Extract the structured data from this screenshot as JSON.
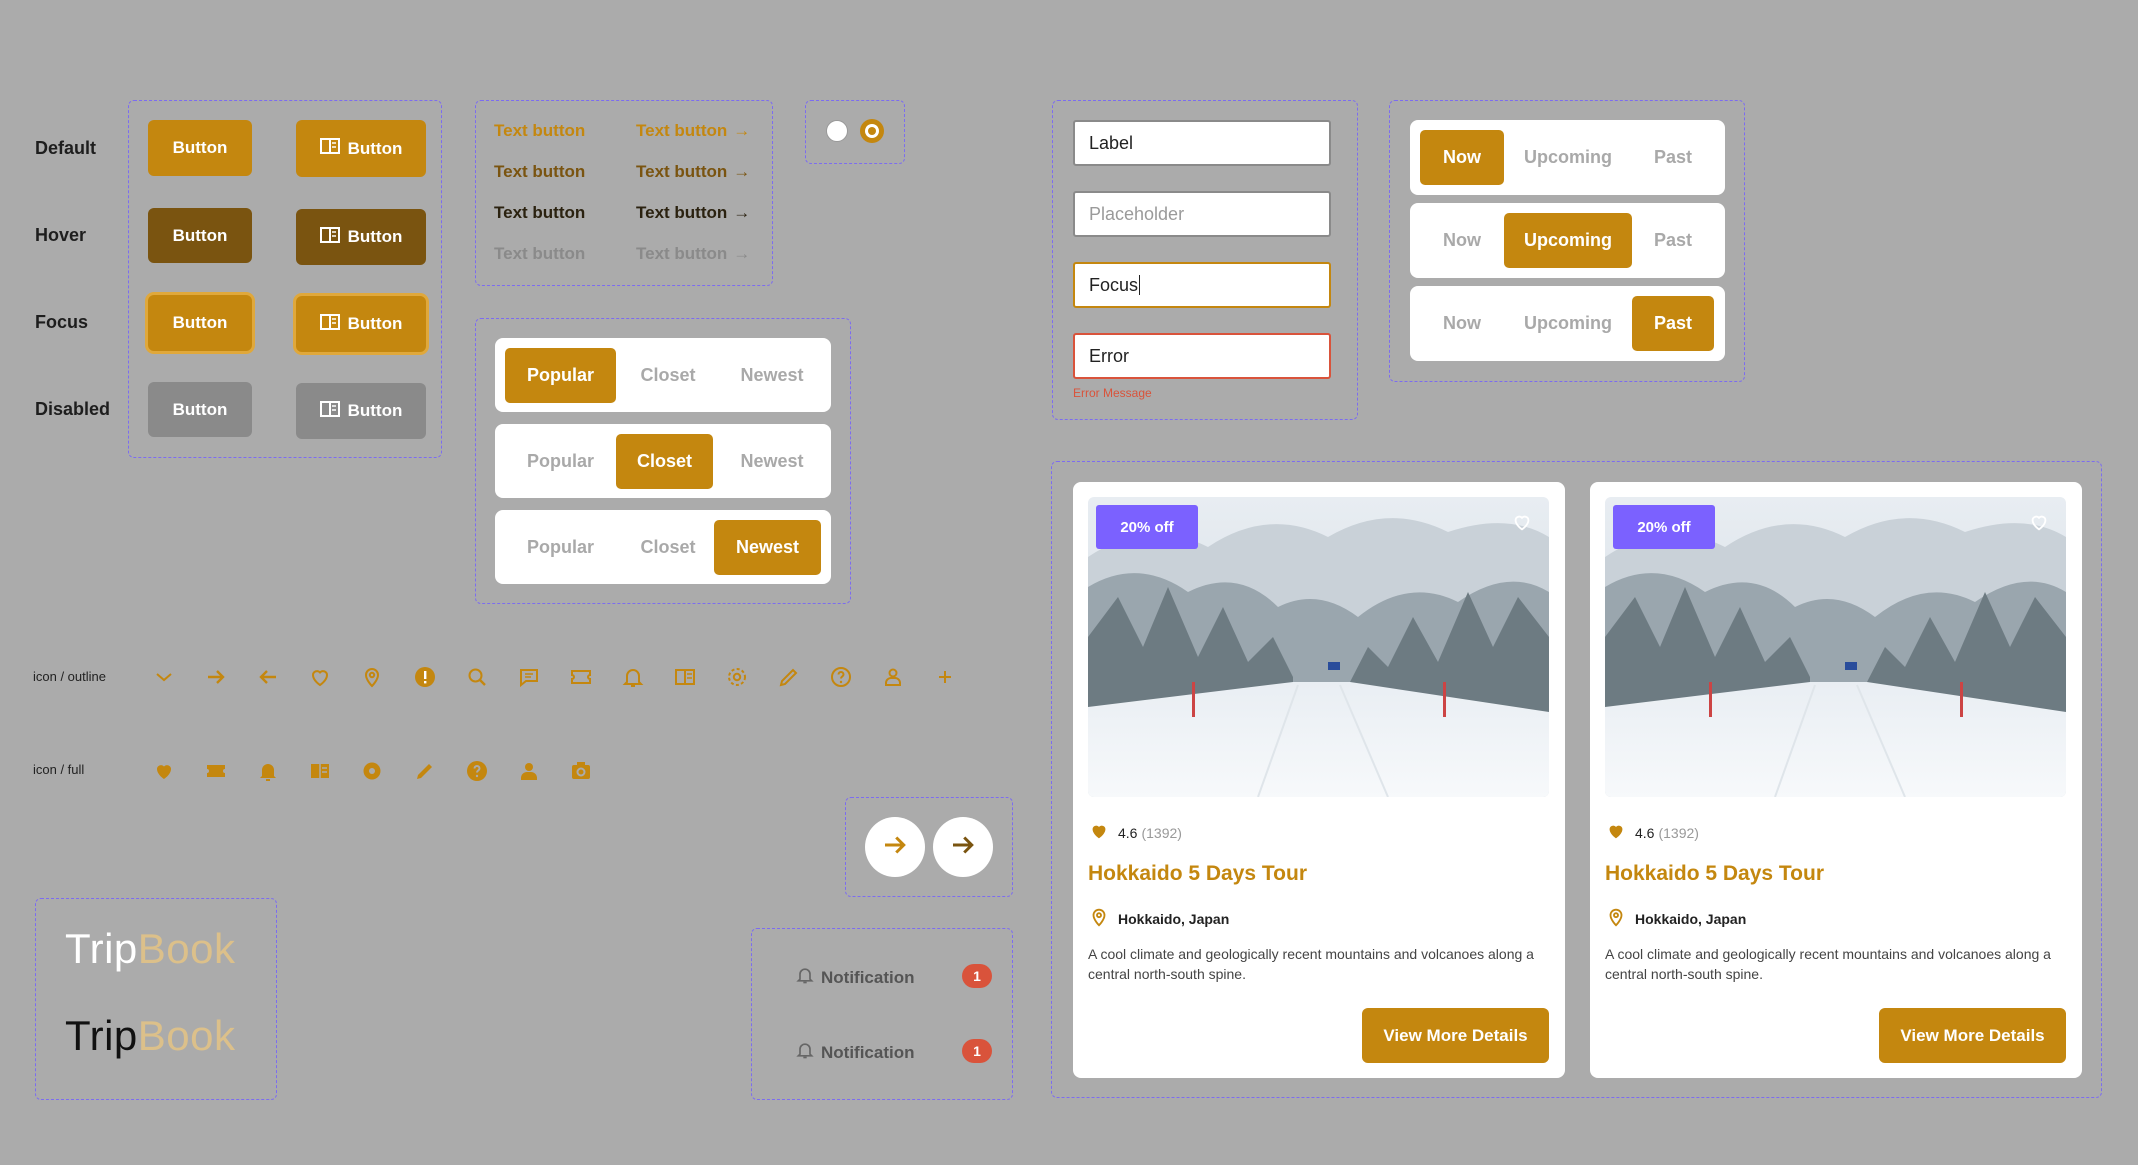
{
  "colors": {
    "primary": "#c4870f",
    "hover": "#7a5410",
    "disabled": "#8a8a8a",
    "accent": "#7b61ff",
    "error": "#d9533b",
    "background": "#ababab"
  },
  "states": {
    "default": "Default",
    "hover": "Hover",
    "focus": "Focus",
    "disabled": "Disabled"
  },
  "buttons": {
    "label": "Button"
  },
  "text_buttons": {
    "label": "Text button"
  },
  "tabs_a": {
    "items": [
      "Popular",
      "Closet",
      "Newest"
    ]
  },
  "tabs_b": {
    "items": [
      "Now",
      "Upcoming",
      "Past"
    ]
  },
  "inputs": {
    "label_value": "Label",
    "placeholder": "Placeholder",
    "focus_value": "Focus",
    "error_value": "Error",
    "error_message": "Error Message"
  },
  "icon_rows": {
    "outline_label": "icon / outline",
    "full_label": "icon / full"
  },
  "icons_outline": [
    "chevron-down-icon",
    "arrow-right-icon",
    "arrow-left-icon",
    "heart-icon",
    "location-pin-icon",
    "alert-icon",
    "search-icon",
    "chat-icon",
    "ticket-icon",
    "bell-icon",
    "book-icon",
    "gear-icon",
    "pencil-icon",
    "help-icon",
    "user-icon",
    "plus-icon"
  ],
  "icons_full": [
    "heart-icon",
    "ticket-icon",
    "bell-icon",
    "book-icon",
    "gear-icon",
    "pencil-icon",
    "help-icon",
    "user-icon",
    "camera-icon"
  ],
  "logo": {
    "part1": "Trip",
    "part2": "Book"
  },
  "notifications": {
    "label": "Notification",
    "count": "1"
  },
  "cards": [
    {
      "badge": "20% off",
      "rating": "4.6",
      "reviews": "(1392)",
      "title": "Hokkaido 5 Days Tour",
      "location": "Hokkaido, Japan",
      "description": "A cool climate and geologically recent mountains and volcanoes along a central north-south spine.",
      "cta": "View More Details"
    },
    {
      "badge": "20% off",
      "rating": "4.6",
      "reviews": "(1392)",
      "title": "Hokkaido 5 Days Tour",
      "location": "Hokkaido, Japan",
      "description": "A cool climate and geologically recent mountains and volcanoes along a central north-south spine.",
      "cta": "View More Details"
    }
  ]
}
